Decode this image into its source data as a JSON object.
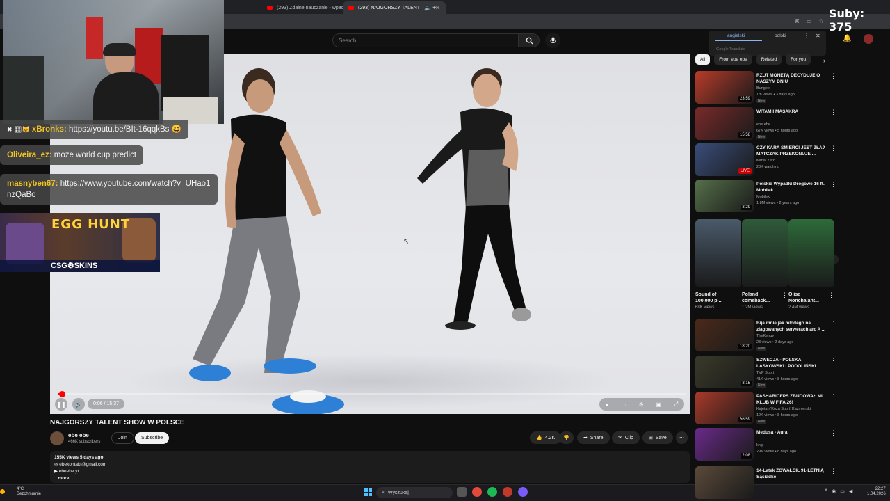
{
  "browser": {
    "tabs": [
      {
        "label": "(293) Zdalne nauczanie - wpad",
        "active": false
      },
      {
        "label": "(293) NAJGORSZY TALENT",
        "active": true
      }
    ],
    "new_tab": "+"
  },
  "stream_overlay": {
    "subs_counter": "Suby: 375",
    "chat": [
      {
        "user": "xBronks:",
        "text": "https://youtu.be/BIt-16qqkBs 😄",
        "prefix": "✖ 🎛😺"
      },
      {
        "user": "Oliveira_ez:",
        "text": "moze world cup predict"
      },
      {
        "user": "masnyben67:",
        "text": "https://www.youtube.com/watch?v=UHao1nzQaBo"
      }
    ],
    "ad": {
      "title": "EGG HUNT",
      "brand": "CSG⚙SKINS"
    }
  },
  "header": {
    "search_placeholder": "Search"
  },
  "translate_popup": {
    "lang_from": "angielski",
    "lang_to": "polski",
    "footer": "Google Translate"
  },
  "player": {
    "time": "0:06 / 15:37",
    "progress": 0.006
  },
  "video": {
    "title": "NAJGORSZY TALENT SHOW W POLSCE",
    "channel": "ebe ebe",
    "subscribers": "466K subscribers",
    "join": "Join",
    "subscribe": "Subscribe",
    "likes": "4.2K",
    "share": "Share",
    "clip": "Clip",
    "save": "Save",
    "description": {
      "stats": "155K views  5 days ago",
      "email": "ebekontakt@gmail.com",
      "site": "ebeebe.yt",
      "more": "...more"
    }
  },
  "sidebar": {
    "chips": [
      "All",
      "From ebe ebe",
      "Related",
      "For you"
    ],
    "recs_top": [
      {
        "title": "RZUT MONETĄ DECYDUJE O NASZYM DNIU",
        "channel": "Bungee",
        "meta": "1m views • 3 days ago",
        "badge": "New",
        "dur": "23:59",
        "color": "#b83b2a"
      },
      {
        "title": "WITAM I MASAKRA",
        "channel": "ebe ebe",
        "meta": "67K views • 5 hours ago",
        "badge": "New",
        "dur": "15:58",
        "color": "#7a2a2a"
      },
      {
        "title": "CZY KARA ŚMIERCI JEST ZŁA? MATCZAK PRZEKONUJE ...",
        "channel": "Kanał Zero",
        "meta": "28K watching",
        "badge": "",
        "dur": "LIVE",
        "color": "#3a4d7a"
      },
      {
        "title": "Polskie Wypadki Drogowe 16 ft. Mobilek",
        "channel": "Mobilek",
        "meta": "1.8M views • 2 years ago",
        "badge": "",
        "dur": "3:29",
        "color": "#55704a"
      }
    ],
    "shorts": [
      {
        "title": "Sound of 100,000 pl...",
        "views": "68K views",
        "color": "#4a5a6a"
      },
      {
        "title": "Poland comeback...",
        "views": "1.2M views",
        "color": "#2f5a3a"
      },
      {
        "title": "Olise Nonchalant...",
        "views": "2.4M views",
        "color": "#2e6a3a"
      }
    ],
    "recs_bottom": [
      {
        "title": "Bija mnie jak mlodego na zlagowanych serwerach arc A ...",
        "channel": "TheKenuy",
        "meta": "23 views • 2 days ago",
        "badge": "New",
        "dur": "18:20",
        "color": "#4a2a1a"
      },
      {
        "title": "SZWECJA - POLSKA: LASKOWSKI I PODOLIŃSKI ...",
        "channel": "TVP Sport",
        "meta": "41K views • 8 hours ago",
        "badge": "New",
        "dur": "3:15",
        "color": "#3a3a2a"
      },
      {
        "title": "PASHABICEPS ZBUDOWAŁ MI KLUB W FIFA 26!",
        "channel": "Kajetan 'Koza Sport' Kaźmierski",
        "meta": "12K views • 8 hours ago",
        "badge": "New",
        "dur": "56:59",
        "color": "#a83a2a"
      },
      {
        "title": "Medusa - Aura",
        "channel": "kng",
        "meta": "29K views • 8 days ago",
        "badge": "",
        "dur": "2:08",
        "color": "#6a2a8a"
      },
      {
        "title": "14-Latek ZGWAŁCIŁ 91-LETNIĄ Sąsiadkę",
        "channel": "",
        "meta": "",
        "badge": "",
        "dur": "",
        "color": "#5a4a3a"
      }
    ]
  },
  "taskbar": {
    "weather_temp": "4°C",
    "weather_desc": "Bezchmurnie",
    "search": "Wyszukaj",
    "time": "22:27",
    "date": "1.04.2026"
  },
  "colors": {
    "accent": "#ff0000",
    "chat_user": "#f0c420"
  }
}
